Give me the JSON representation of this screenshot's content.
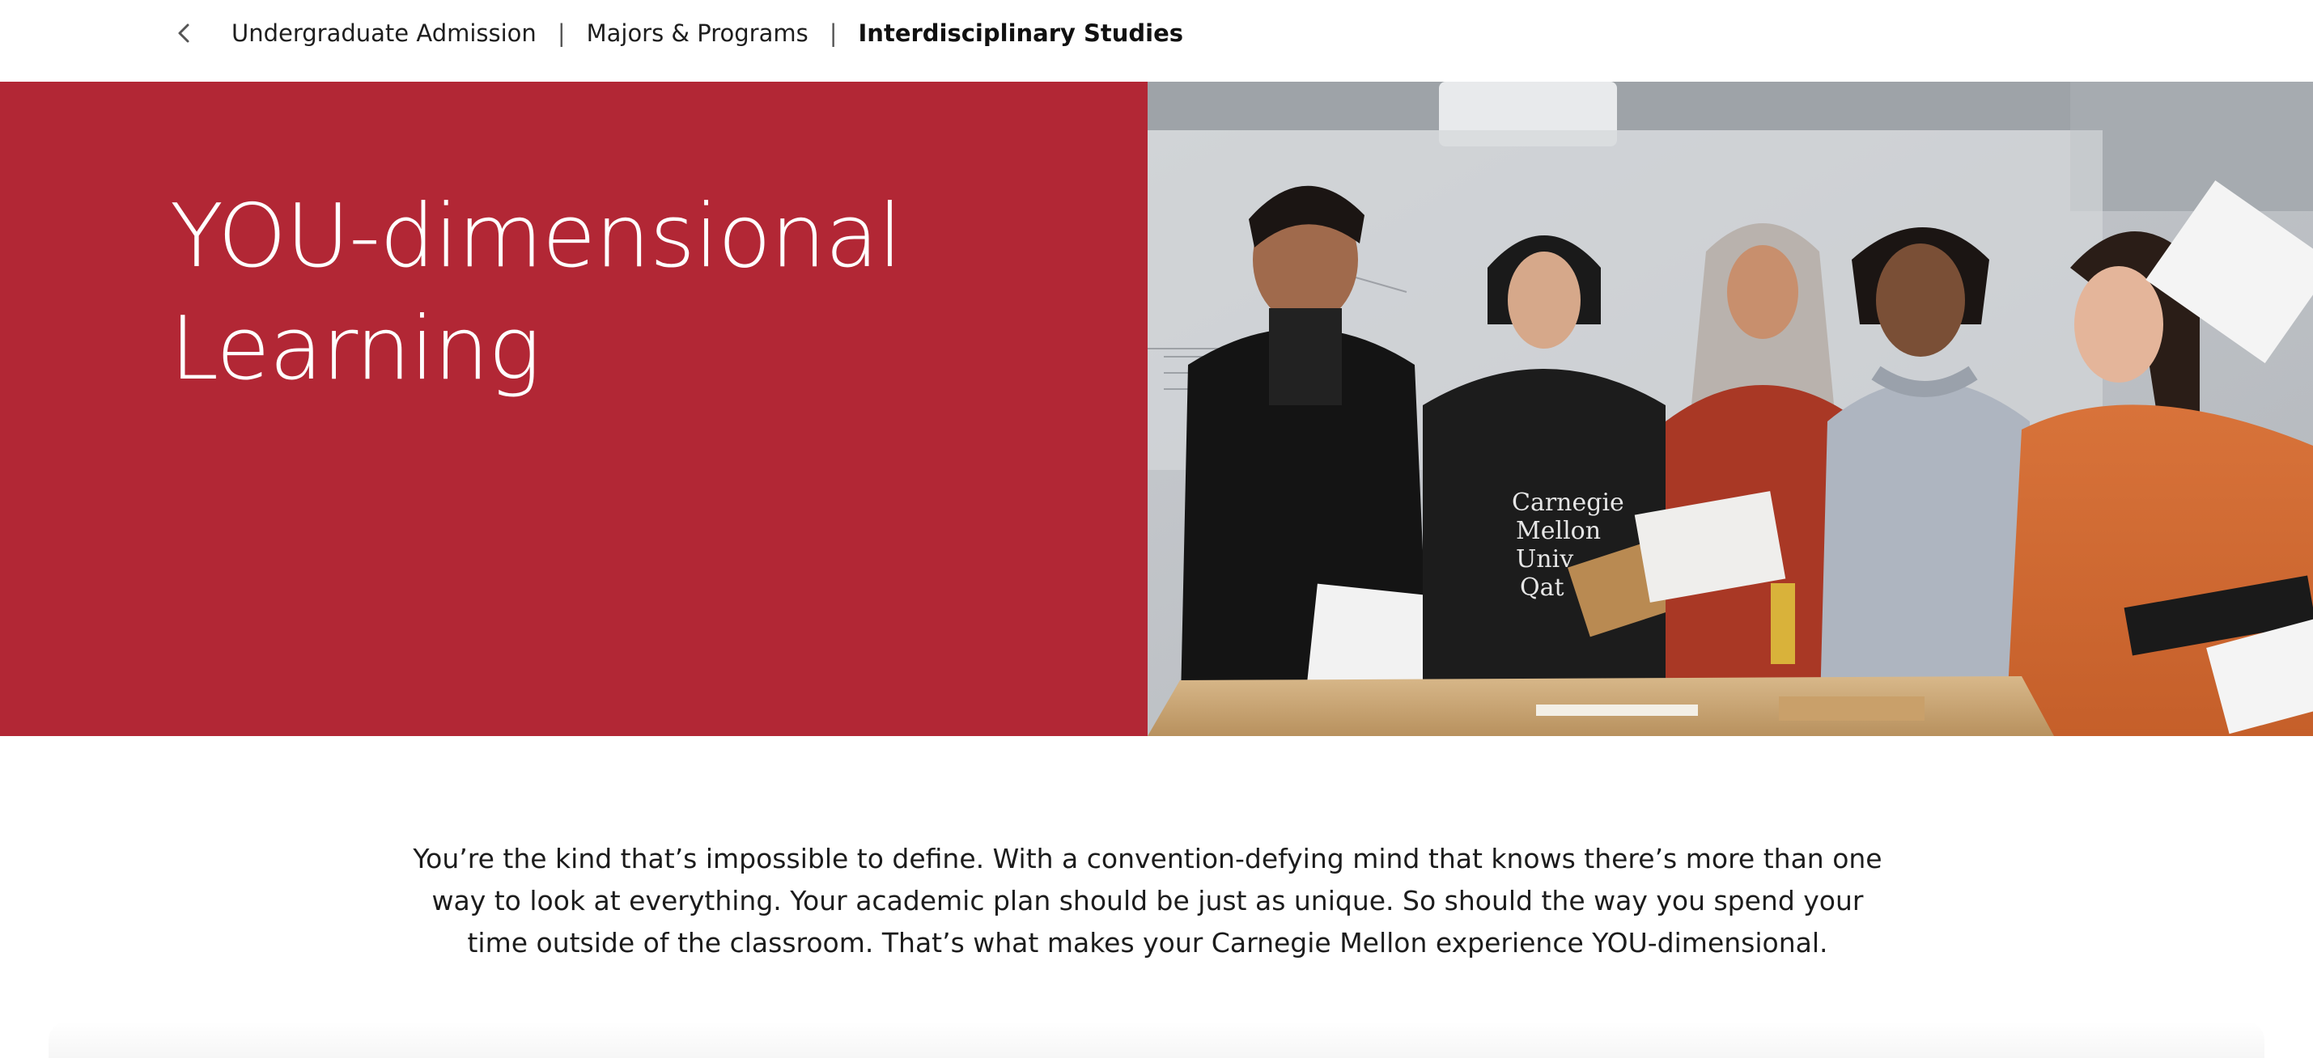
{
  "breadcrumb": {
    "back_icon": "chevron-left-icon",
    "items": [
      {
        "label": "Undergraduate Admission"
      },
      {
        "label": "Majors & Programs"
      },
      {
        "label": "Interdisciplinary Studies"
      }
    ],
    "separator": "|"
  },
  "hero": {
    "title_line1": "YOU-dimensional",
    "title_line2": "Learning",
    "bg_color": "#b22735",
    "photo_alt": "Students examining papers around a workbench",
    "photo_sweatshirt_text": [
      "Carnegie",
      "Mellon",
      "Univ",
      "Qat"
    ]
  },
  "intro": {
    "text": "You’re the kind that’s impossible to define. With a convention-defying mind that knows there’s more than one way to look at everything. Your academic plan should be just as unique. So should the way you spend your time outside of the classroom. That’s what makes your Carnegie Mellon experience YOU-dimensional."
  }
}
